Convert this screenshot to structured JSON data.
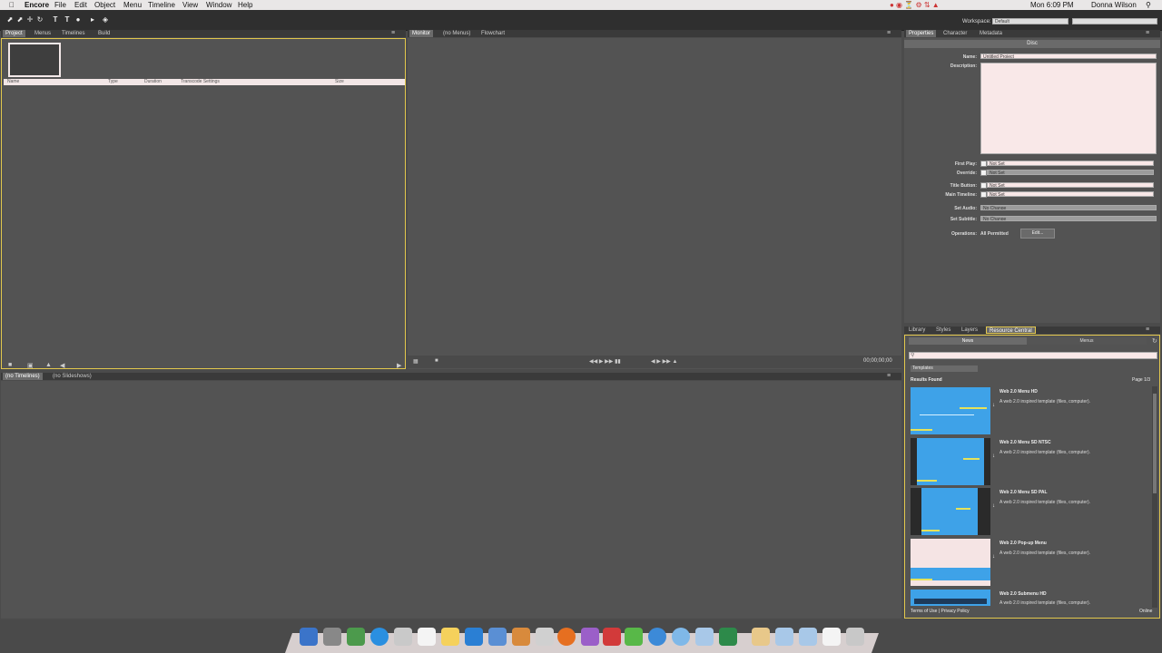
{
  "menubar": {
    "apple": "",
    "app": "Encore",
    "items": [
      "File",
      "Edit",
      "Object",
      "Menu",
      "Timeline",
      "View",
      "Window",
      "Help"
    ],
    "right_status": "Mon 6:09 PM",
    "user": "Donna Wilson"
  },
  "toolbar": {
    "workspace_label": "Workspace:",
    "workspace_value": "Default"
  },
  "project_panel": {
    "tabs": [
      "Project",
      "Menus",
      "Timelines",
      "Build"
    ],
    "columns": [
      "Name",
      "Type",
      "Duration",
      "Transcode Settings",
      "Size"
    ]
  },
  "viewer_panel": {
    "tabs": [
      "Monitor",
      "(no Menus)",
      "Flowchart"
    ],
    "timecode": "00;00;00;00"
  },
  "bottom_panel": {
    "tabs": [
      "(no Timelines)",
      "(no Slideshows)"
    ]
  },
  "properties_panel": {
    "tabs": [
      "Properties",
      "Character",
      "Metadata"
    ],
    "subtitle": "Disc",
    "name_label": "Name:",
    "name_value": "Untitled Project",
    "description_label": "Description:",
    "first_play_label": "First Play:",
    "first_play_value": "Not Set",
    "override_label": "Override:",
    "override_value": "Not Set",
    "title_button_label": "Title Button:",
    "title_button_value": "Not Set",
    "main_timeline_label": "Main Timeline:",
    "main_timeline_value": "Not Set",
    "set_audio_label": "Set Audio:",
    "set_audio_value": "No Change",
    "set_subtitle_label": "Set Subtitle:",
    "set_subtitle_value": "No Change",
    "operations_label": "Operations:",
    "operations_value": "All Permitted",
    "edit_button": "Edit..."
  },
  "resource_panel": {
    "tabs": [
      "Library",
      "Styles",
      "Layers",
      "Resource Central"
    ],
    "subtabs": [
      "News",
      "Menus"
    ],
    "category": "Templates",
    "results_label": "Results Found",
    "page_label": "Page 1/3",
    "results": [
      {
        "title": "Web 2.0 Menu HD",
        "desc": "A web 2.0 inspired template (files, computer)."
      },
      {
        "title": "Web 2.0 Menu SD NTSC",
        "desc": "A web 2.0 inspired template (files, computer)."
      },
      {
        "title": "Web 2.0 Menu SD PAL",
        "desc": "A web 2.0 inspired template (files, computer)."
      },
      {
        "title": "Web 2.0 Pop-up Menu",
        "desc": "A web 2.0 inspired template (files, computer)."
      },
      {
        "title": "Web 2.0 Submenu HD",
        "desc": "A web 2.0 inspired template (files, computer)."
      }
    ],
    "footer_links": "Terms of Use | Privacy Policy",
    "online_label": "Online"
  },
  "colors": {
    "accent_yellow": "#e3c84d",
    "thumb_blue": "#3ea2e8",
    "field_bg": "#f9e8e8"
  }
}
